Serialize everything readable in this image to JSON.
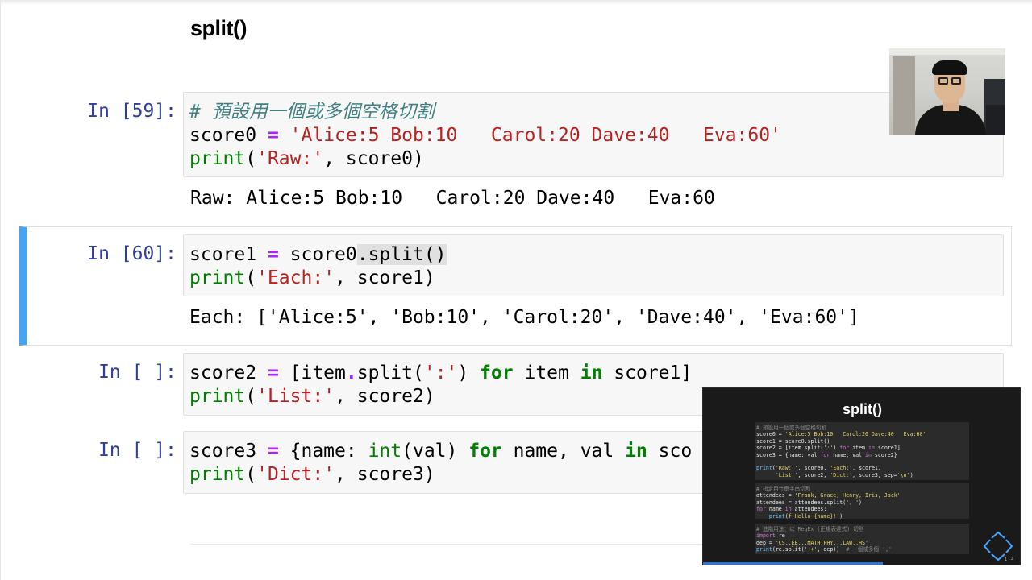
{
  "page": {
    "heading": "split()"
  },
  "cells": [
    {
      "prompt": "In [59]:",
      "lines": [
        [
          {
            "t": "# 預設用一個或多個空格切割",
            "c": "cm"
          }
        ],
        [
          {
            "t": "score0 ",
            "c": "nm"
          },
          {
            "t": "=",
            "c": "op"
          },
          {
            "t": " ",
            "c": "nm"
          },
          {
            "t": "'Alice:5 Bob:10   Carol:20 Dave:40   Eva:60'",
            "c": "str"
          }
        ],
        [
          {
            "t": "print",
            "c": "bi"
          },
          {
            "t": "(",
            "c": "nm"
          },
          {
            "t": "'Raw:'",
            "c": "str"
          },
          {
            "t": ", score0)",
            "c": "nm"
          }
        ]
      ],
      "output": "Raw: Alice:5 Bob:10   Carol:20 Dave:40   Eva:60"
    },
    {
      "prompt": "In [60]:",
      "lines": [
        [
          {
            "t": "score1 ",
            "c": "nm"
          },
          {
            "t": "=",
            "c": "op"
          },
          {
            "t": " score0",
            "c": "nm"
          },
          {
            "t": ".split()",
            "c": "hl"
          }
        ],
        [
          {
            "t": "print",
            "c": "bi"
          },
          {
            "t": "(",
            "c": "nm"
          },
          {
            "t": "'Each:'",
            "c": "str"
          },
          {
            "t": ", score1)",
            "c": "nm"
          }
        ]
      ],
      "output": "Each: ['Alice:5', 'Bob:10', 'Carol:20', 'Dave:40', 'Eva:60']"
    },
    {
      "prompt": "In [ ]:",
      "lines": [
        [
          {
            "t": "score2 ",
            "c": "nm"
          },
          {
            "t": "=",
            "c": "op"
          },
          {
            "t": " [item",
            "c": "nm"
          },
          {
            "t": ".",
            "c": "op"
          },
          {
            "t": "split(",
            "c": "nm"
          },
          {
            "t": "':'",
            "c": "str"
          },
          {
            "t": ") ",
            "c": "nm"
          },
          {
            "t": "for",
            "c": "kw"
          },
          {
            "t": " item ",
            "c": "nm"
          },
          {
            "t": "in",
            "c": "kw"
          },
          {
            "t": " score1]",
            "c": "nm"
          }
        ],
        [
          {
            "t": "print",
            "c": "bi"
          },
          {
            "t": "(",
            "c": "nm"
          },
          {
            "t": "'List:'",
            "c": "str"
          },
          {
            "t": ", score2)",
            "c": "nm"
          }
        ]
      ]
    },
    {
      "prompt": "In [ ]:",
      "lines": [
        [
          {
            "t": "score3 ",
            "c": "nm"
          },
          {
            "t": "=",
            "c": "op"
          },
          {
            "t": " {name: ",
            "c": "nm"
          },
          {
            "t": "int",
            "c": "bi"
          },
          {
            "t": "(val) ",
            "c": "nm"
          },
          {
            "t": "for",
            "c": "kw"
          },
          {
            "t": " name, val ",
            "c": "nm"
          },
          {
            "t": "in",
            "c": "kw"
          },
          {
            "t": " sco",
            "c": "nm"
          }
        ],
        [
          {
            "t": "print",
            "c": "bi"
          },
          {
            "t": "(",
            "c": "nm"
          },
          {
            "t": "'Dict:'",
            "c": "str"
          },
          {
            "t": ", score3)",
            "c": "nm"
          }
        ]
      ]
    }
  ],
  "overlay": {
    "title": "split()",
    "blocks": [
      [
        [
          {
            "t": "# 預設用一個或多個空格切割",
            "c": "cm"
          }
        ],
        [
          {
            "t": "score0 = ",
            "c": "nm"
          },
          {
            "t": "'Alice:5 Bob:10   Carol:20 Dave:40   Eva:60'",
            "c": "str"
          }
        ],
        [
          {
            "t": "score1 = score0.split()",
            "c": "nm"
          }
        ],
        [
          {
            "t": "score2 = [item.split(",
            "c": "nm"
          },
          {
            "t": "':'",
            "c": "str"
          },
          {
            "t": ") ",
            "c": "nm"
          },
          {
            "t": "for",
            "c": "kw"
          },
          {
            "t": " item ",
            "c": "nm"
          },
          {
            "t": "in",
            "c": "kw"
          },
          {
            "t": " score1]",
            "c": "nm"
          }
        ],
        [
          {
            "t": "score3 = {name: val ",
            "c": "nm"
          },
          {
            "t": "for",
            "c": "kw"
          },
          {
            "t": " name, val ",
            "c": "nm"
          },
          {
            "t": "in",
            "c": "kw"
          },
          {
            "t": " score2}",
            "c": "nm"
          }
        ],
        [
          {
            "t": " ",
            "c": "nm"
          }
        ],
        [
          {
            "t": "print",
            "c": "bi"
          },
          {
            "t": "(",
            "c": "nm"
          },
          {
            "t": "'Raw: '",
            "c": "str"
          },
          {
            "t": ", score0, ",
            "c": "nm"
          },
          {
            "t": "'Each:'",
            "c": "str"
          },
          {
            "t": ", score1,",
            "c": "nm"
          }
        ],
        [
          {
            "t": "      ",
            "c": "nm"
          },
          {
            "t": "'List:'",
            "c": "str"
          },
          {
            "t": ", score2, ",
            "c": "nm"
          },
          {
            "t": "'Dict:'",
            "c": "str"
          },
          {
            "t": ", score3, sep=",
            "c": "nm"
          },
          {
            "t": "'\\n'",
            "c": "str"
          },
          {
            "t": ")",
            "c": "nm"
          }
        ]
      ],
      [
        [
          {
            "t": "# 指定用什麼字串切割",
            "c": "cm"
          }
        ],
        [
          {
            "t": "attendees = ",
            "c": "nm"
          },
          {
            "t": "'Frank, Grace, Henry, Iris, Jack'",
            "c": "str"
          }
        ],
        [
          {
            "t": "attendees = attendees.split(",
            "c": "nm"
          },
          {
            "t": "', '",
            "c": "str"
          },
          {
            "t": ")",
            "c": "nm"
          }
        ],
        [
          {
            "t": "for",
            "c": "kw"
          },
          {
            "t": " name ",
            "c": "nm"
          },
          {
            "t": "in",
            "c": "kw"
          },
          {
            "t": " attendees:",
            "c": "nm"
          }
        ],
        [
          {
            "t": "    ",
            "c": "nm"
          },
          {
            "t": "print",
            "c": "bi"
          },
          {
            "t": "(",
            "c": "nm"
          },
          {
            "t": "f'Hello {name}!'",
            "c": "str"
          },
          {
            "t": ")",
            "c": "nm"
          }
        ]
      ],
      [
        [
          {
            "t": "# 進階用法：以 RegEx (正規表達式) 切割",
            "c": "cm"
          }
        ],
        [
          {
            "t": "import",
            "c": "kw"
          },
          {
            "t": " re",
            "c": "nm"
          }
        ],
        [
          {
            "t": "dep = ",
            "c": "nm"
          },
          {
            "t": "'CS,,EE,,,MATH,PHY,,,LAW,,HS'",
            "c": "str"
          }
        ],
        [
          {
            "t": "print",
            "c": "bi"
          },
          {
            "t": "(re.split(",
            "c": "nm"
          },
          {
            "t": "',+'",
            "c": "str"
          },
          {
            "t": ", dep))  ",
            "c": "nm"
          },
          {
            "t": "# 一個或多個 ','",
            "c": "cm"
          }
        ]
      ]
    ],
    "page_indicator": "1 - 4"
  }
}
